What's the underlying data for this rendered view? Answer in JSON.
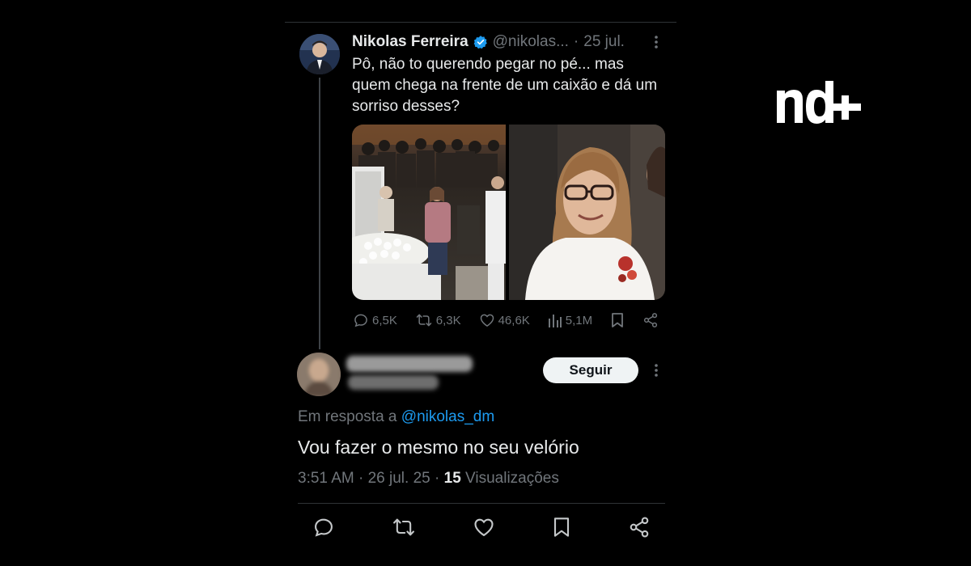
{
  "tweet": {
    "author": "Nikolas Ferreira",
    "handle": "@nikolas...",
    "separator": "·",
    "date": "25 jul.",
    "text": "Pô, não to querendo pegar no pé... mas quem chega na frente de um caixão e dá um sorriso desses?",
    "stats": {
      "replies": "6,5K",
      "retweets": "6,3K",
      "likes": "46,6K",
      "views": "5,1M"
    }
  },
  "reply": {
    "follow_label": "Seguir",
    "reply_to_prefix": "Em resposta a",
    "reply_to_handle": "@nikolas_dm",
    "text": "Vou fazer o mesmo no seu velório",
    "time": "3:51 AM",
    "date": "26 jul. 25",
    "separator": "·",
    "views_count": "15",
    "views_label": "Visualizações"
  },
  "colors": {
    "background": "#000000",
    "text": "#e7e9ea",
    "muted": "#71767b",
    "link": "#1d9bf0",
    "verified": "#1d9bf0",
    "follow_button": "#eff3f4"
  },
  "logo": "nd+"
}
